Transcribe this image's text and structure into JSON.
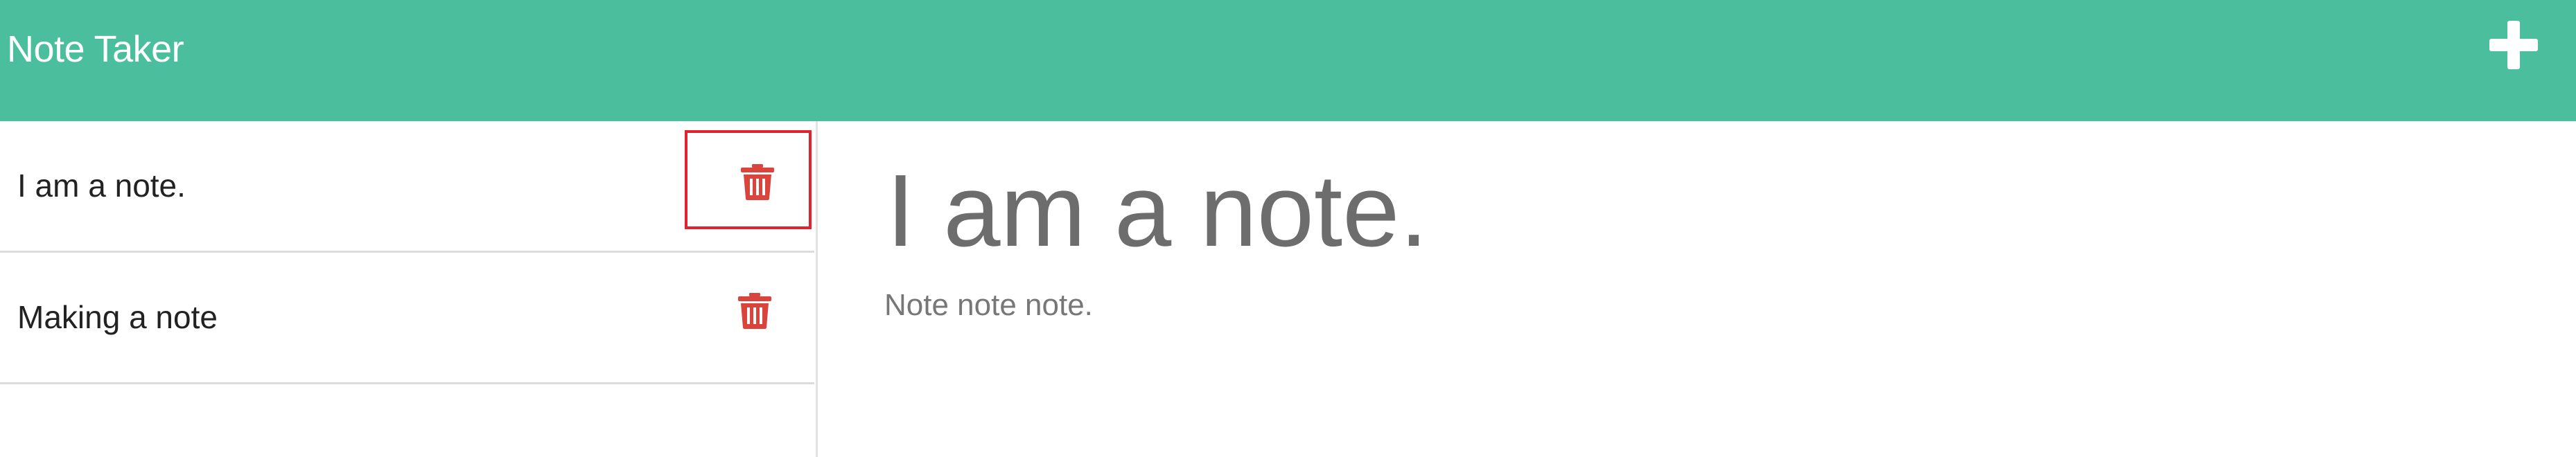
{
  "navbar": {
    "brand": "Note Taker",
    "new_note_icon": "plus-icon",
    "background_color": "#4bbf9d"
  },
  "sidebar": {
    "notes": [
      {
        "title": "I am a note.",
        "delete_icon": "trash-icon",
        "selected": true
      },
      {
        "title": "Making a note",
        "delete_icon": "trash-icon",
        "selected": false
      }
    ]
  },
  "editor": {
    "title": "I am a note.",
    "body": "Note note note."
  },
  "colors": {
    "accent": "#4bbf9d",
    "danger": "#d9453c",
    "highlight": "#e0232e"
  }
}
